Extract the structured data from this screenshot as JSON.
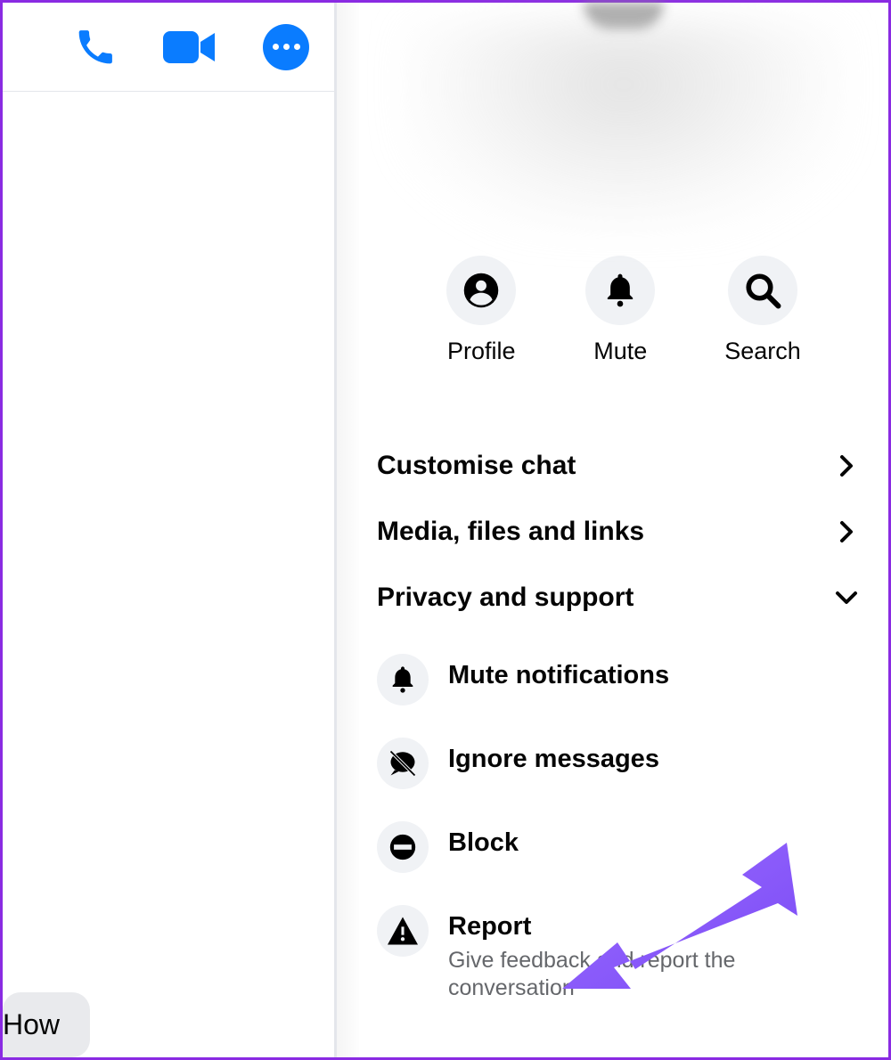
{
  "header": {
    "call_icon": "phone-icon",
    "video_icon": "video-icon",
    "more_icon": "more-icon"
  },
  "actions": {
    "profile_label": "Profile",
    "mute_label": "Mute",
    "search_label": "Search"
  },
  "sections": {
    "customise": "Customise chat",
    "media": "Media, files and links",
    "privacy": "Privacy and support"
  },
  "privacy_items": {
    "mute_notifications": "Mute notifications",
    "ignore_messages": "Ignore messages",
    "block": "Block",
    "report": "Report",
    "report_desc": "Give feedback and report the conversation"
  },
  "message_text": "How",
  "colors": {
    "accent": "#0a7cff",
    "annotation": "#8a5cf6"
  }
}
